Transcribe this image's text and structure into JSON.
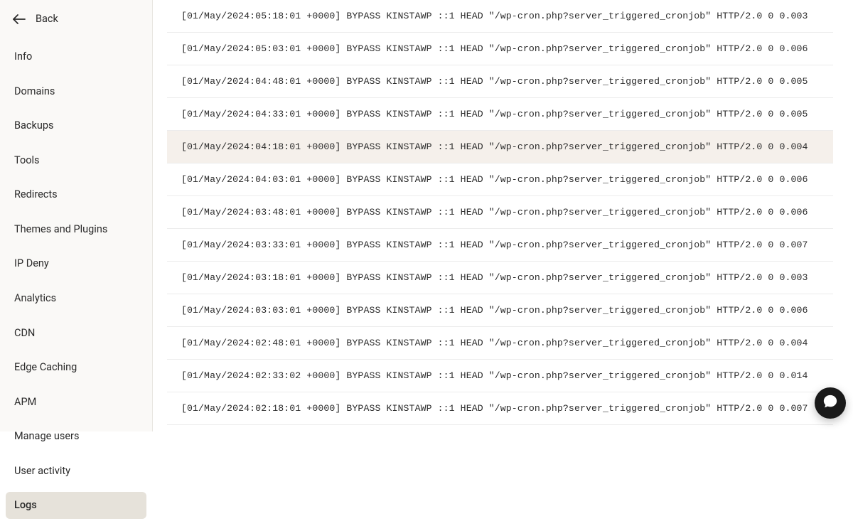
{
  "back": {
    "label": "Back"
  },
  "sidebar": {
    "items": [
      {
        "label": "Info",
        "active": false
      },
      {
        "label": "Domains",
        "active": false
      },
      {
        "label": "Backups",
        "active": false
      },
      {
        "label": "Tools",
        "active": false
      },
      {
        "label": "Redirects",
        "active": false
      },
      {
        "label": "Themes and Plugins",
        "active": false
      },
      {
        "label": "IP Deny",
        "active": false
      },
      {
        "label": "Analytics",
        "active": false
      },
      {
        "label": "CDN",
        "active": false
      },
      {
        "label": "Edge Caching",
        "active": false
      },
      {
        "label": "APM",
        "active": false
      },
      {
        "label": "Manage users",
        "active": false
      },
      {
        "label": "User activity",
        "active": false
      },
      {
        "label": "Logs",
        "active": true
      }
    ]
  },
  "logs": [
    {
      "text": "[01/May/2024:05:18:01 +0000] BYPASS KINSTAWP ::1 HEAD \"/wp-cron.php?server_triggered_cronjob\" HTTP/2.0 0 0.003",
      "highlight": false
    },
    {
      "text": "[01/May/2024:05:03:01 +0000] BYPASS KINSTAWP ::1 HEAD \"/wp-cron.php?server_triggered_cronjob\" HTTP/2.0 0 0.006",
      "highlight": false
    },
    {
      "text": "[01/May/2024:04:48:01 +0000] BYPASS KINSTAWP ::1 HEAD \"/wp-cron.php?server_triggered_cronjob\" HTTP/2.0 0 0.005",
      "highlight": false
    },
    {
      "text": "[01/May/2024:04:33:01 +0000] BYPASS KINSTAWP ::1 HEAD \"/wp-cron.php?server_triggered_cronjob\" HTTP/2.0 0 0.005",
      "highlight": false
    },
    {
      "text": "[01/May/2024:04:18:01 +0000] BYPASS KINSTAWP ::1 HEAD \"/wp-cron.php?server_triggered_cronjob\" HTTP/2.0 0 0.004",
      "highlight": true
    },
    {
      "text": "[01/May/2024:04:03:01 +0000] BYPASS KINSTAWP ::1 HEAD \"/wp-cron.php?server_triggered_cronjob\" HTTP/2.0 0 0.006",
      "highlight": false
    },
    {
      "text": "[01/May/2024:03:48:01 +0000] BYPASS KINSTAWP ::1 HEAD \"/wp-cron.php?server_triggered_cronjob\" HTTP/2.0 0 0.006",
      "highlight": false
    },
    {
      "text": "[01/May/2024:03:33:01 +0000] BYPASS KINSTAWP ::1 HEAD \"/wp-cron.php?server_triggered_cronjob\" HTTP/2.0 0 0.007",
      "highlight": false
    },
    {
      "text": "[01/May/2024:03:18:01 +0000] BYPASS KINSTAWP ::1 HEAD \"/wp-cron.php?server_triggered_cronjob\" HTTP/2.0 0 0.003",
      "highlight": false
    },
    {
      "text": "[01/May/2024:03:03:01 +0000] BYPASS KINSTAWP ::1 HEAD \"/wp-cron.php?server_triggered_cronjob\" HTTP/2.0 0 0.006",
      "highlight": false
    },
    {
      "text": "[01/May/2024:02:48:01 +0000] BYPASS KINSTAWP ::1 HEAD \"/wp-cron.php?server_triggered_cronjob\" HTTP/2.0 0 0.004",
      "highlight": false
    },
    {
      "text": "[01/May/2024:02:33:02 +0000] BYPASS KINSTAWP ::1 HEAD \"/wp-cron.php?server_triggered_cronjob\" HTTP/2.0 0 0.014",
      "highlight": false
    },
    {
      "text": "[01/May/2024:02:18:01 +0000] BYPASS KINSTAWP ::1 HEAD \"/wp-cron.php?server_triggered_cronjob\" HTTP/2.0 0 0.007",
      "highlight": false
    }
  ]
}
